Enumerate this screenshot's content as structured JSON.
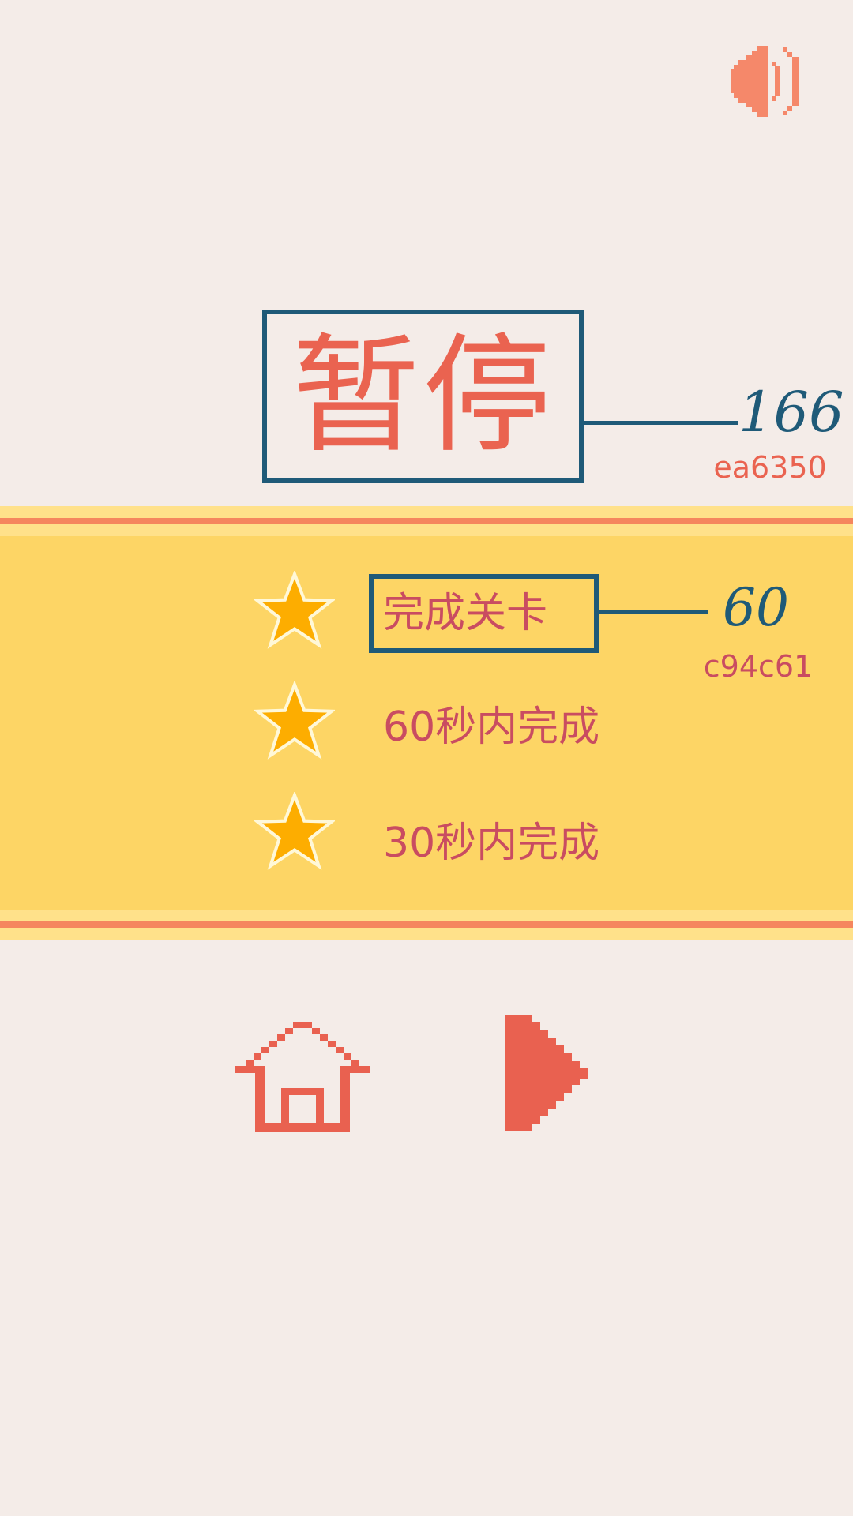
{
  "sound_button": {
    "icon": "speaker-on-icon"
  },
  "title": {
    "text": "暂停",
    "size_annotation": "166",
    "color_annotation": "ea6350"
  },
  "objectives": [
    {
      "text": "完成关卡",
      "star_icon": "star-icon"
    },
    {
      "text": "60秒内完成",
      "star_icon": "star-icon"
    },
    {
      "text": "30秒内完成",
      "star_icon": "star-icon"
    }
  ],
  "objective_annotation": {
    "size_annotation": "60",
    "color_annotation": "c94c61"
  },
  "buttons": {
    "home_icon": "home-icon",
    "resume_icon": "play-icon"
  },
  "colors": {
    "background": "#f4ece8",
    "title": "#ea6350",
    "objective_text": "#c94c61",
    "annotation_frame": "#1f5a78",
    "banner": "#fdd565",
    "banner_stripe": "#f5865e",
    "star_fill": "#fdad00",
    "icon": "#e96150",
    "speaker": "#f5886a"
  }
}
